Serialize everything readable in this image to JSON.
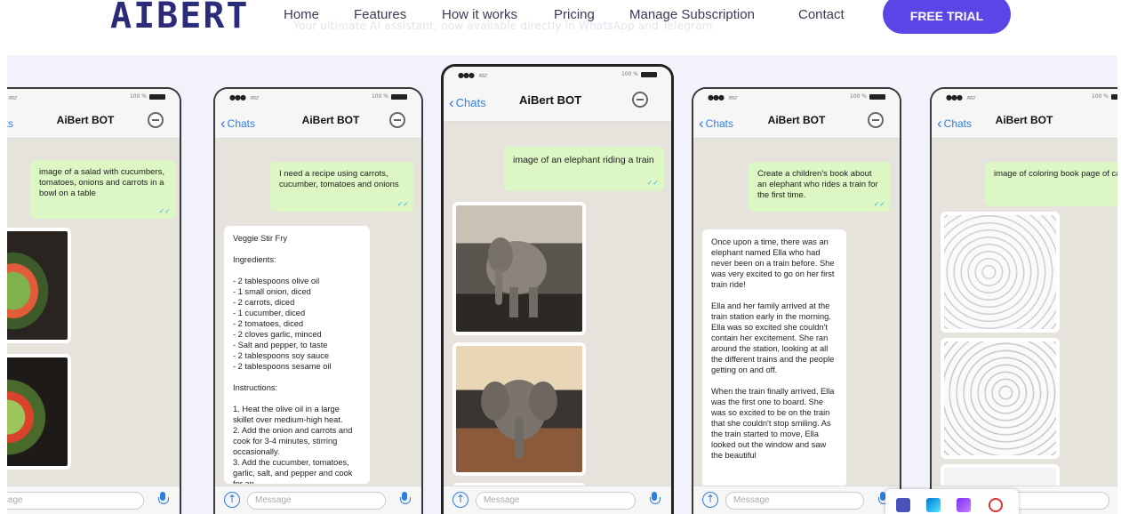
{
  "brand": {
    "logo_text": "AIBERT",
    "partial_subtitle": "Your ultimate AI assistant, now available directly in WhatsApp and Telegram"
  },
  "nav": {
    "items": [
      "Home",
      "Features",
      "How it works",
      "Pricing",
      "Manage Subscription",
      "Contact"
    ],
    "cta": "FREE TRIAL"
  },
  "phone_ui": {
    "carrier": "AT&T",
    "battery": "100 %",
    "back_label": "Chats",
    "title": "AiBert BOT",
    "input_placeholder": "Message"
  },
  "phones": [
    {
      "user_message": "image of a salad with cucumbers, tomatoes, onions and carrots in a bowl on a table",
      "reply_images": [
        "salad-image",
        "salad-image"
      ]
    },
    {
      "user_message": "I need a recipe using carrots, cucumber, tomatoes and onions",
      "reply": "Veggie Stir Fry\n\nIngredients:\n\n- 2 tablespoons olive oil\n- 1 small onion, diced\n- 2 carrots, diced\n- 1 cucumber, diced\n- 2 tomatoes, diced\n- 2 cloves garlic, minced\n- Salt and pepper, to taste\n- 2 tablespoons soy sauce\n- 2 tablespoons sesame oil\n\nInstructions:\n\n1. Heat the olive oil in a large skillet over medium-high heat.\n2. Add the onion and carrots and cook for 3-4 minutes, stirring occasionally.\n3. Add the cucumber, tomatoes, garlic, salt, and pepper and cook for an"
    },
    {
      "user_message": "image of an elephant riding a train",
      "reply_images": [
        "elephant-train-image",
        "elephant-train-image"
      ]
    },
    {
      "user_message": "Create a children's book about an elephant who rides a train for the first time.",
      "reply": "Once upon a time, there was an elephant named Ella who had never been on a train before. She was very excited to go on her first train ride!\n\nElla and her family arrived at the train station early in the morning. Ella was so excited she couldn't contain her excitement. She ran around the station, looking at all the different trains and the people getting on and off.\n\nWhen the train finally arrived, Ella was the first one to board. She was so excited to be on the train that she couldn't stop smiling. As the train started to move, Ella looked out the window and saw the beautiful"
    },
    {
      "user_message": "image of coloring book page of cats",
      "reply_images": [
        "cats-coloring-image",
        "cats-coloring-image"
      ]
    }
  ],
  "colors": {
    "accent": "#5a46e6",
    "logo": "#2b2b7a",
    "bubble_out": "#dcf6c4",
    "chat_bg": "#e6e2dc",
    "ios_blue": "#2f7de1"
  }
}
